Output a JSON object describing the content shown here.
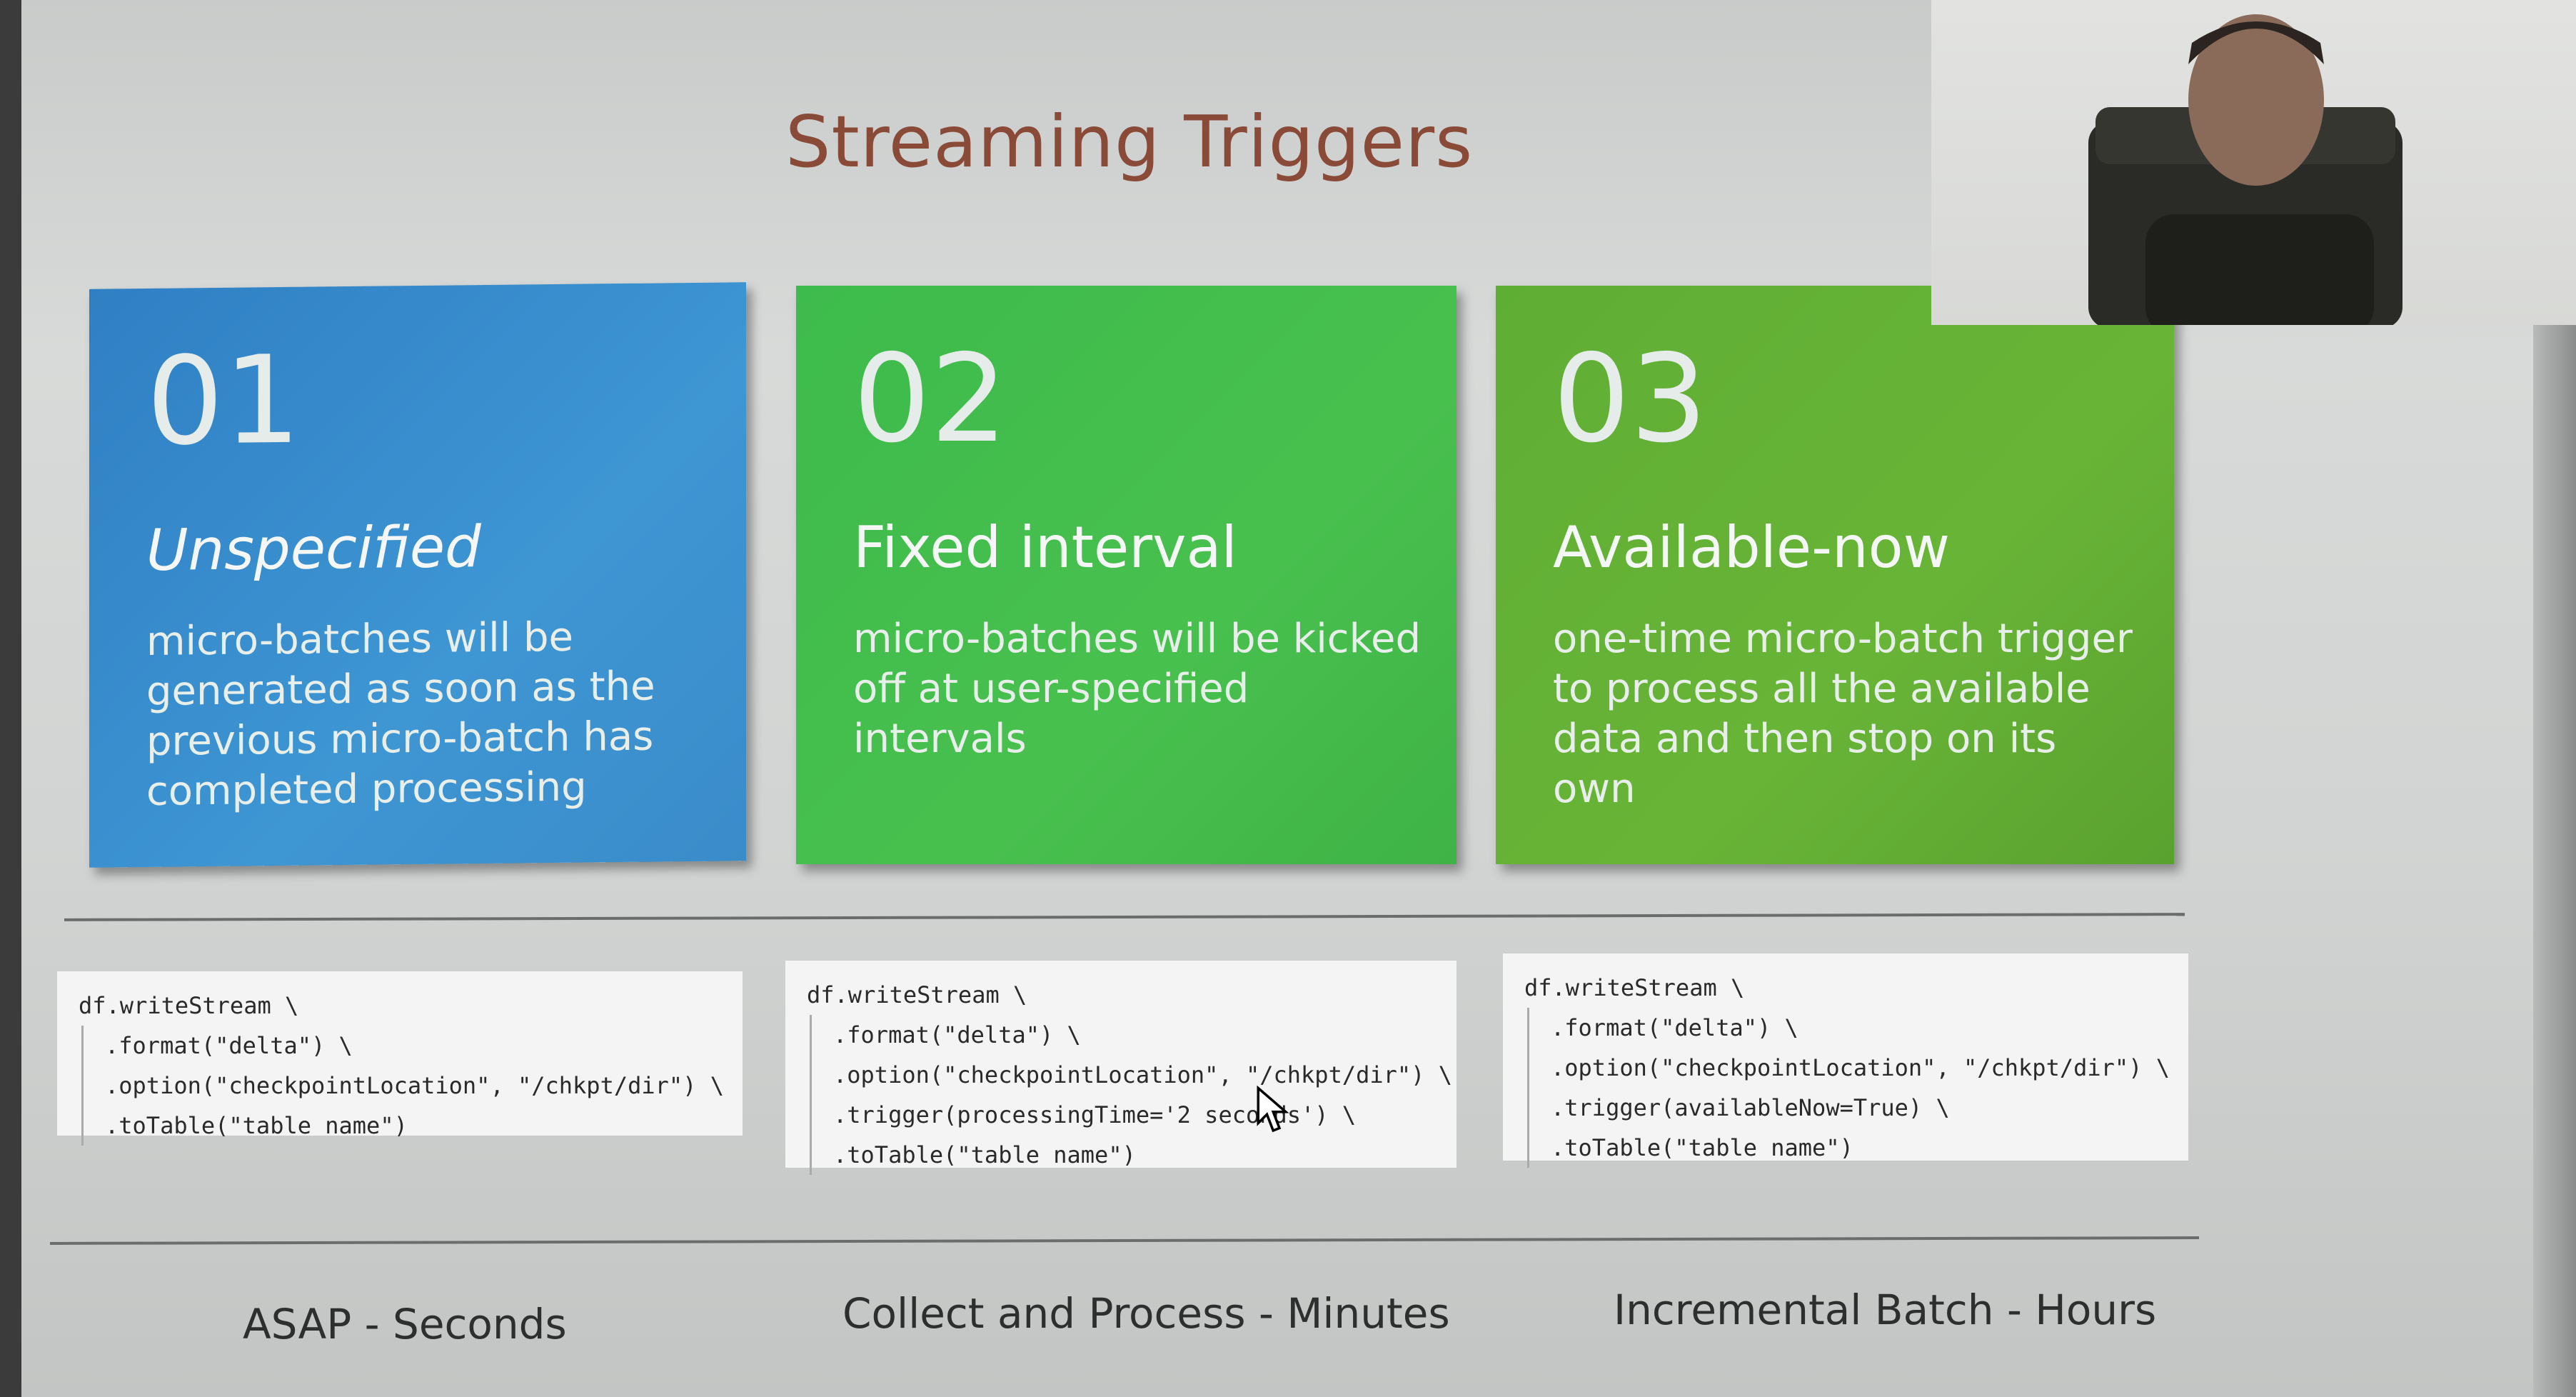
{
  "slide": {
    "title": "Streaming Triggers",
    "cards": [
      {
        "number": "01",
        "heading": "Unspecified",
        "description": "micro-batches will be generated as soon as the previous micro-batch has completed processing"
      },
      {
        "number": "02",
        "heading": "Fixed interval",
        "description": "micro-batches will be kicked off at user-specified intervals"
      },
      {
        "number": "03",
        "heading": "Available-now",
        "description": "one-time micro-batch trigger to process all the available data and then stop on its own"
      }
    ],
    "code_blocks": [
      {
        "lines": [
          "df.writeStream \\",
          ".format(\"delta\") \\",
          ".option(\"checkpointLocation\", \"/chkpt/dir\") \\",
          ".toTable(\"table name\")"
        ]
      },
      {
        "lines": [
          "df.writeStream \\",
          ".format(\"delta\") \\",
          ".option(\"checkpointLocation\", \"/chkpt/dir\") \\",
          ".trigger(processingTime='2 seconds') \\",
          ".toTable(\"table name\")"
        ]
      },
      {
        "lines": [
          "df.writeStream \\",
          ".format(\"delta\") \\",
          ".option(\"checkpointLocation\", \"/chkpt/dir\") \\",
          ".trigger(availableNow=True) \\",
          ".toTable(\"table name\")"
        ]
      }
    ],
    "footers": [
      "ASAP - Seconds",
      "Collect and Process - Minutes",
      "Incremental Batch - Hours"
    ]
  },
  "colors": {
    "title": "#8a4a38",
    "card1": "#3a8cc9",
    "card2": "#45bd4d",
    "card3": "#63ae35"
  },
  "icons": {
    "cursor": "mouse-pointer-icon",
    "webcam": "webcam-video-feed"
  }
}
